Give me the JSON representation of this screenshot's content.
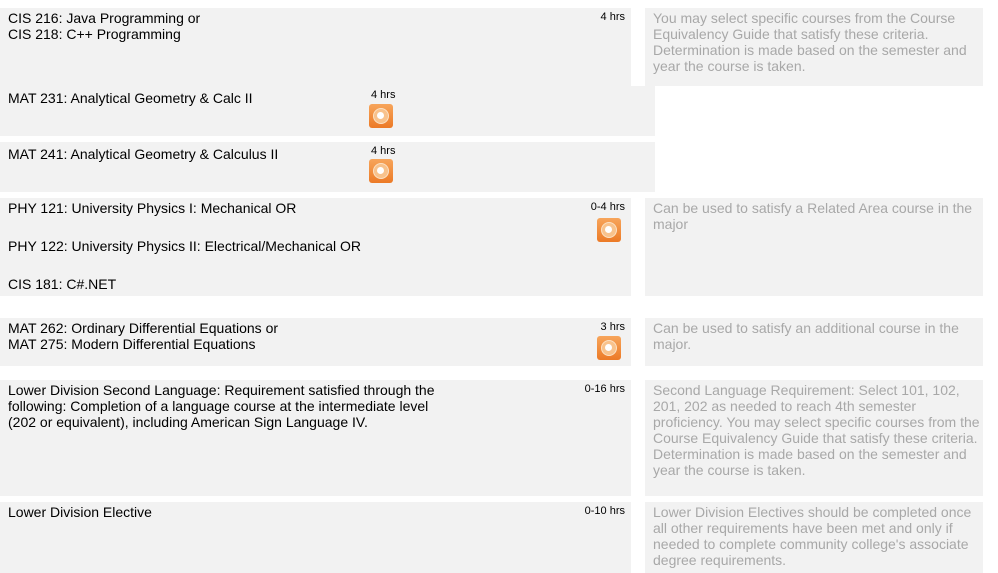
{
  "rows": [
    {
      "courses": [
        "CIS 216: Java Programming or",
        "CIS 218: C++ Programming"
      ],
      "hours": "4 hrs",
      "note": "You may select specific courses from the Course Equivalency Guide that satisfy these criteria. Determination is made based on the semester and year the course is taken."
    },
    {
      "courses": [
        "MAT 231: Analytical Geometry & Calc II"
      ],
      "hours": "4 hrs",
      "icon": "audio-course-icon"
    },
    {
      "courses": [
        "MAT 241: Analytical Geometry & Calculus II"
      ],
      "hours": "4 hrs",
      "icon": "audio-course-icon"
    },
    {
      "courses": [
        "PHY 121: University Physics I: Mechanical OR",
        "PHY 122: University Physics II: Electrical/Mechanical OR",
        "CIS 181: C#.NET"
      ],
      "hours": "0-4 hrs",
      "icon": "audio-course-icon",
      "note": "Can be used to satisfy a Related Area course in the major"
    },
    {
      "courses": [
        "MAT 262: Ordinary Differential Equations or",
        "MAT 275: Modern Differential Equations"
      ],
      "hours": "3 hrs",
      "icon": "audio-course-icon",
      "note": "Can be used to satisfy an additional course in the major."
    },
    {
      "courses": [
        "Lower Division Second Language: Requirement satisfied through the",
        "following: Completion of a language course at the intermediate level",
        "(202 or equivalent), including American Sign Language IV."
      ],
      "hours": "0-16 hrs",
      "note": "Second Language Requirement: Select 101, 102, 201, 202 as needed to reach 4th semester proficiency. You may select specific courses from the Course Equivalency Guide that satisfy these criteria. Determination is made based on the semester and year the course is taken."
    },
    {
      "courses": [
        "Lower Division Elective"
      ],
      "hours": "0-10 hrs",
      "note": "Lower Division Electives should be completed once all other requirements have been met and only if needed to complete community college's associate degree requirements."
    }
  ]
}
